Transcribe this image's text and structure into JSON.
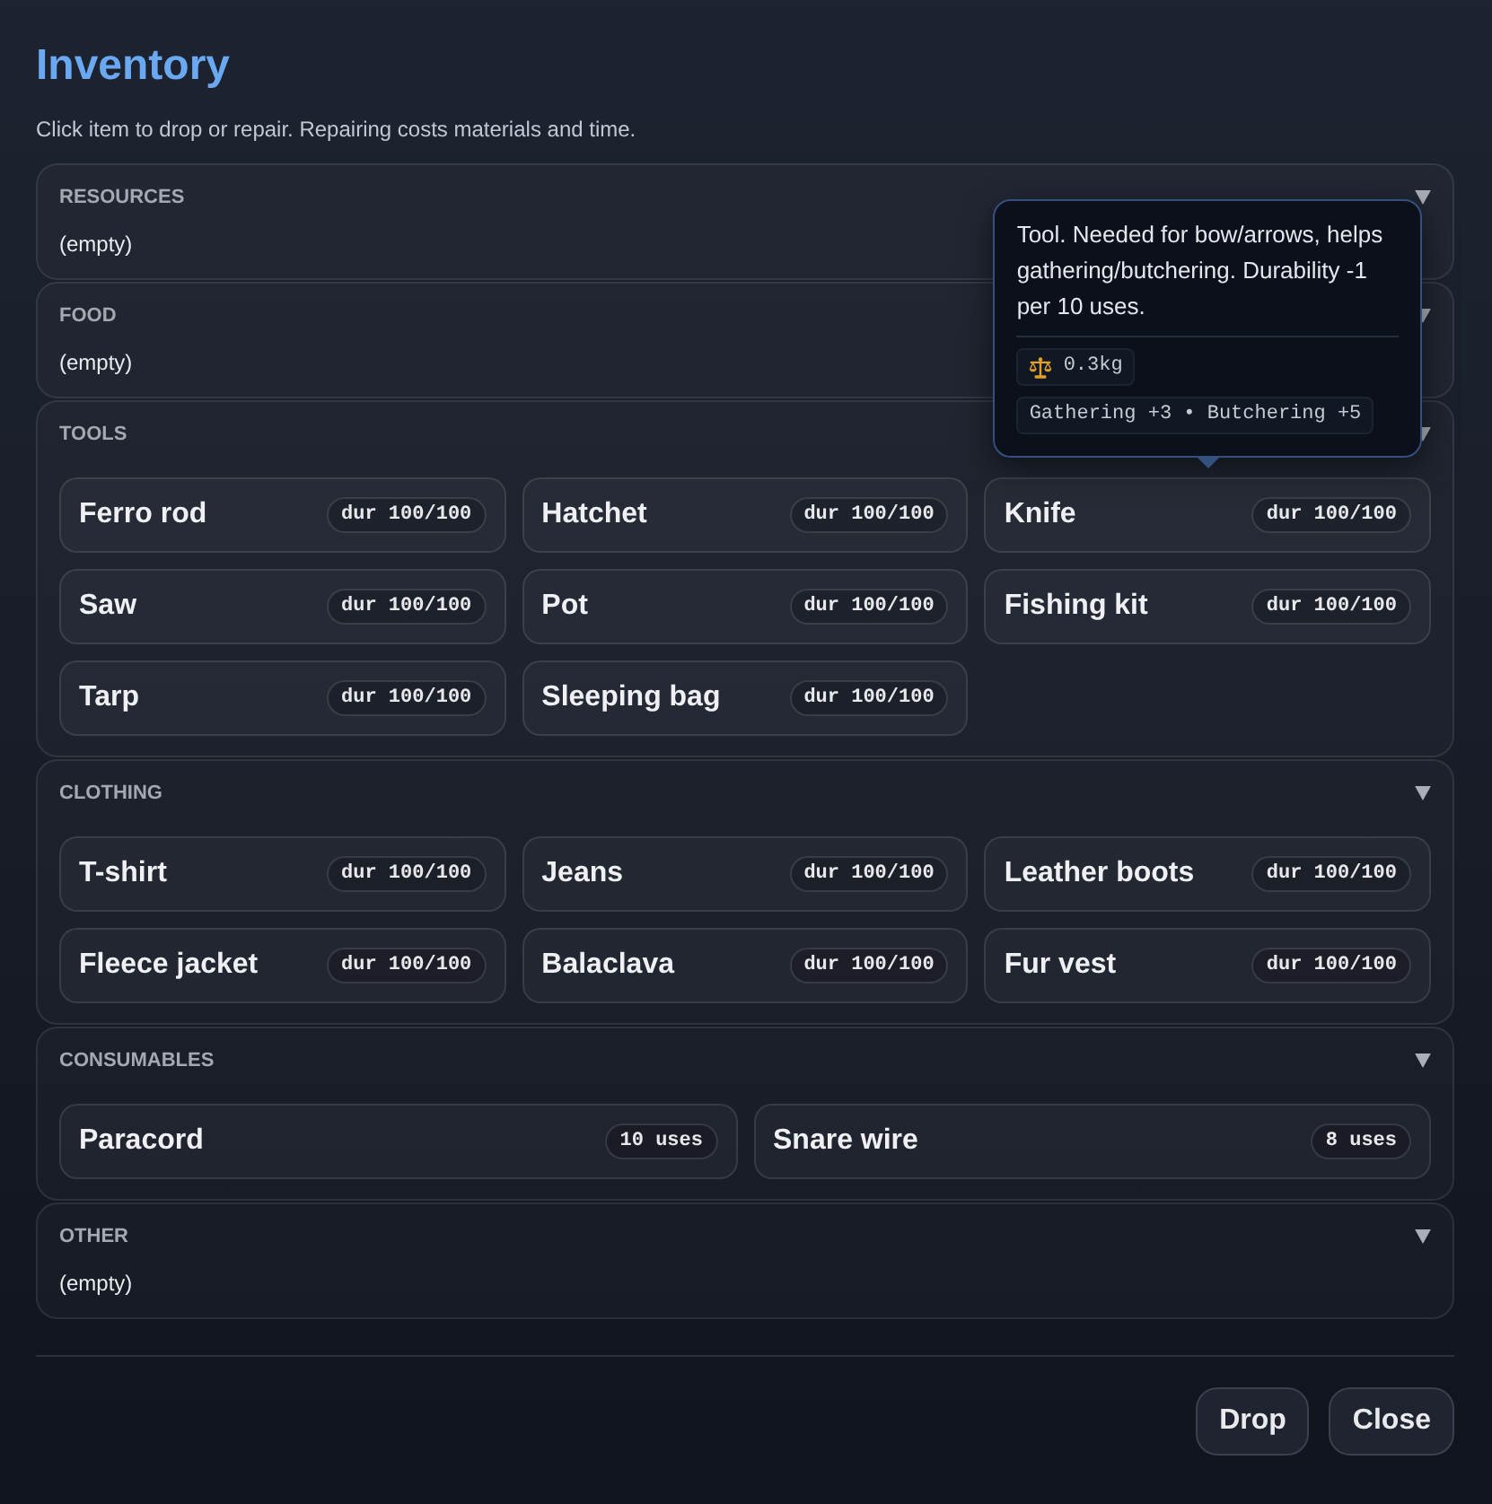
{
  "title": "Inventory",
  "subtitle": "Click item to drop or repair. Repairing costs materials and time.",
  "sections": [
    {
      "title": "RESOURCES",
      "expanded": true,
      "empty_text": "(empty)"
    },
    {
      "title": "FOOD",
      "expanded": true,
      "empty_text": "(empty)"
    },
    {
      "title": "TOOLS",
      "expanded": true,
      "items": [
        {
          "name": "Ferro rod",
          "durability": "dur 100/100"
        },
        {
          "name": "Hatchet",
          "durability": "dur 100/100"
        },
        {
          "name": "Knife",
          "durability": "dur 100/100",
          "tooltip": {
            "description": "Tool. Needed for bow/arrows, helps gathering/butchering. Durability -1 per 10 uses.",
            "weight": "0.3kg",
            "effects": "Gathering +3 • Butchering +5"
          }
        },
        {
          "name": "Saw",
          "durability": "dur 100/100"
        },
        {
          "name": "Pot",
          "durability": "dur 100/100"
        },
        {
          "name": "Fishing kit",
          "durability": "dur 100/100"
        },
        {
          "name": "Tarp",
          "durability": "dur 100/100"
        },
        {
          "name": "Sleeping bag",
          "durability": "dur 100/100"
        }
      ]
    },
    {
      "title": "CLOTHING",
      "expanded": true,
      "items": [
        {
          "name": "T-shirt",
          "durability": "dur 100/100"
        },
        {
          "name": "Jeans",
          "durability": "dur 100/100"
        },
        {
          "name": "Leather boots",
          "durability": "dur 100/100"
        },
        {
          "name": "Fleece jacket",
          "durability": "dur 100/100"
        },
        {
          "name": "Balaclava",
          "durability": "dur 100/100"
        },
        {
          "name": "Fur vest",
          "durability": "dur 100/100"
        }
      ]
    },
    {
      "title": "CONSUMABLES",
      "expanded": true,
      "items": [
        {
          "name": "Paracord",
          "uses": "10 uses"
        },
        {
          "name": "Snare wire",
          "uses": "8 uses"
        }
      ]
    },
    {
      "title": "OTHER",
      "expanded": true,
      "empty_text": "(empty)"
    }
  ],
  "buttons": [
    {
      "label": "Drop"
    },
    {
      "label": "Close"
    }
  ]
}
